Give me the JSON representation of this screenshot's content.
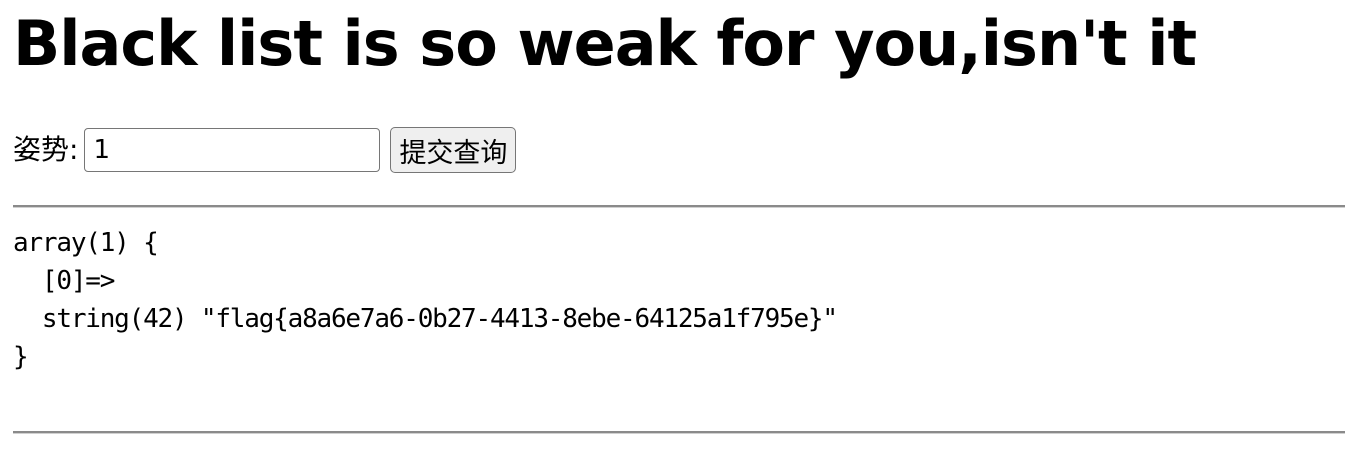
{
  "heading": "Black list is so weak for you,isn't it",
  "form": {
    "label": "姿势:",
    "input_value": "1",
    "submit_label": "提交查询"
  },
  "output": {
    "lines": [
      "array(1) {",
      "  [0]=>",
      "  string(42) \"flag{a8a6e7a6-0b27-4413-8ebe-64125a1f795e}\"",
      "}"
    ]
  }
}
